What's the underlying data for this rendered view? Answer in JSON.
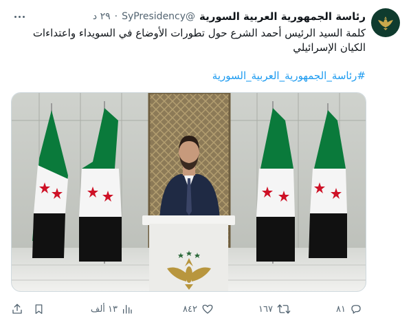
{
  "tweet": {
    "author_name": "رئاسة الجمهورية العربية السورية",
    "handle": "@SyPresidency",
    "separator": "·",
    "time": "٢٩ د",
    "text": "كلمة السيد الرئيس أحمد الشرع حول تطورات الأوضاع في السويداء واعتداءات الكيان الإسرائيلي",
    "hashtag": "#رئاسة_الجمهورية_العربية_السورية"
  },
  "actions": {
    "replies": "٨١",
    "reposts": "١٦٧",
    "likes": "٨٤٢",
    "views": "١٣ ألف"
  },
  "icons": [
    "more-icon",
    "avatar-emblem-icon",
    "reply-icon",
    "repost-icon",
    "like-icon",
    "views-icon",
    "bookmark-icon",
    "share-icon"
  ],
  "colors": {
    "text": "#0f1419",
    "secondary": "#536471",
    "link": "#1d9bf0",
    "avatar_bg": "#0f3b2e",
    "flag_green": "#0a7a3b",
    "flag_red": "#ce1126"
  }
}
